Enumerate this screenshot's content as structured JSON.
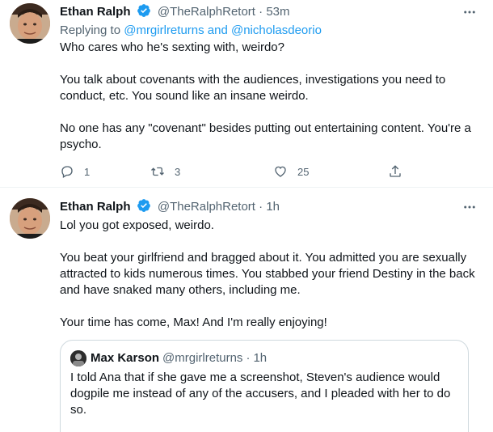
{
  "colors": {
    "accent": "#1d9bf0",
    "secondary_text": "#536471",
    "border": "#eff3f4"
  },
  "tweets": [
    {
      "author_name": "Ethan Ralph",
      "handle": "@TheRalphRetort",
      "separator": "·",
      "time": "53m",
      "verified": true,
      "replying_to_label": "Replying to",
      "replying_to_users": "@mrgirlreturns and @nicholasdeorio",
      "paragraphs": [
        "Who cares who he's sexting with, weirdo?",
        "You talk about covenants with the audiences, investigations you need to conduct, etc. You sound like an insane weirdo.",
        "No one has any \"covenant\" besides putting out entertaining content. You're a psycho."
      ],
      "actions": {
        "reply_count": "1",
        "retweet_count": "3",
        "like_count": "25"
      }
    },
    {
      "author_name": "Ethan Ralph",
      "handle": "@TheRalphRetort",
      "separator": "·",
      "time": "1h",
      "verified": true,
      "paragraphs": [
        "Lol you got exposed, weirdo.",
        "You beat your girlfriend and bragged about it. You admitted you are sexually attracted to kids numerous times. You stabbed your friend Destiny in the back and have snaked many others, including me.",
        "Your time has come, Max! And I'm really enjoying!"
      ],
      "quote": {
        "author_name": "Max Karson",
        "handle": "@mrgirlreturns",
        "separator": "·",
        "time": "1h",
        "text": "I told Ana that if she gave me a screenshot, Steven's audience would dogpile me instead of any of the accusers, and I pleaded with her to do so."
      }
    }
  ]
}
